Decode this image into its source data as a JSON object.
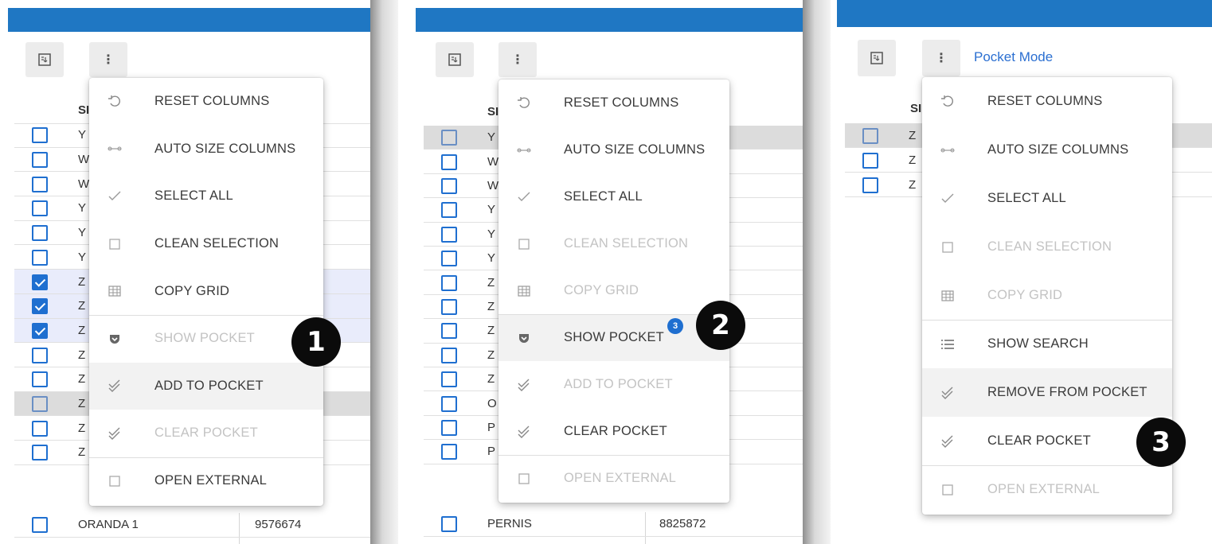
{
  "toolbar": {
    "grid_icon": "grid-export-icon",
    "more_label": "⋮"
  },
  "panel3": {
    "mode_label": "Pocket Mode"
  },
  "header": {
    "column_name_partial": "SI"
  },
  "panel1": {
    "rows": [
      {
        "name": "Y"
      },
      {
        "name": "W"
      },
      {
        "name": "W"
      },
      {
        "name": "Y"
      },
      {
        "name": "Y"
      },
      {
        "name": "Y"
      },
      {
        "name": "Z"
      },
      {
        "name": "Z"
      },
      {
        "name": "Z"
      },
      {
        "name": "Z"
      },
      {
        "name": "Z"
      },
      {
        "name": "Z"
      },
      {
        "name": "Z"
      },
      {
        "name": "Z"
      }
    ],
    "last_row": {
      "name": "ORANDA 1",
      "value": "9576674"
    },
    "menu": [
      {
        "label": "RESET COLUMNS",
        "icon": "undo-icon"
      },
      {
        "label": "AUTO SIZE COLUMNS",
        "icon": "resize-icon"
      },
      {
        "label": "SELECT ALL",
        "icon": "check-icon"
      },
      {
        "label": "CLEAN SELECTION",
        "icon": "checkbox-empty-icon"
      },
      {
        "label": "COPY GRID",
        "icon": "grid-icon"
      },
      {
        "label": "SHOW POCKET",
        "icon": "pocket-icon"
      },
      {
        "label": "ADD TO POCKET",
        "icon": "double-check-icon"
      },
      {
        "label": "CLEAR POCKET",
        "icon": "double-check-icon"
      },
      {
        "label": "OPEN EXTERNAL",
        "icon": "checkbox-empty-icon"
      }
    ],
    "callout": "1"
  },
  "panel2": {
    "rows": [
      {
        "name": "Y"
      },
      {
        "name": "W"
      },
      {
        "name": "W"
      },
      {
        "name": "Y"
      },
      {
        "name": "Y"
      },
      {
        "name": "Y"
      },
      {
        "name": "Z"
      },
      {
        "name": "Z"
      },
      {
        "name": "Z"
      },
      {
        "name": "Z"
      },
      {
        "name": "Z"
      },
      {
        "name": "O"
      },
      {
        "name": "P"
      },
      {
        "name": "P"
      }
    ],
    "last_row": {
      "name": "PERNIS",
      "value": "8825872"
    },
    "menu": [
      {
        "label": "RESET COLUMNS",
        "icon": "undo-icon"
      },
      {
        "label": "AUTO SIZE COLUMNS",
        "icon": "resize-icon"
      },
      {
        "label": "SELECT ALL",
        "icon": "check-icon"
      },
      {
        "label": "CLEAN SELECTION",
        "icon": "checkbox-empty-icon"
      },
      {
        "label": "COPY GRID",
        "icon": "grid-icon"
      },
      {
        "label": "SHOW POCKET",
        "icon": "pocket-icon"
      },
      {
        "label": "ADD TO POCKET",
        "icon": "double-check-icon"
      },
      {
        "label": "CLEAR POCKET",
        "icon": "double-check-icon"
      },
      {
        "label": "OPEN EXTERNAL",
        "icon": "checkbox-empty-icon"
      }
    ],
    "pocket_count": "3",
    "callout": "2"
  },
  "panel3_grid": {
    "rows": [
      {
        "name": "Z"
      },
      {
        "name": "Z"
      },
      {
        "name": "Z"
      }
    ],
    "menu": [
      {
        "label": "RESET COLUMNS",
        "icon": "undo-icon"
      },
      {
        "label": "AUTO SIZE COLUMNS",
        "icon": "resize-icon"
      },
      {
        "label": "SELECT ALL",
        "icon": "check-icon"
      },
      {
        "label": "CLEAN SELECTION",
        "icon": "checkbox-empty-icon"
      },
      {
        "label": "COPY GRID",
        "icon": "grid-icon"
      },
      {
        "label": "SHOW SEARCH",
        "icon": "list-icon"
      },
      {
        "label": "REMOVE FROM POCKET",
        "icon": "double-check-icon"
      },
      {
        "label": "CLEAR POCKET",
        "icon": "double-check-icon"
      },
      {
        "label": "OPEN EXTERNAL",
        "icon": "checkbox-empty-icon"
      }
    ],
    "callout": "3"
  },
  "colors": {
    "accent": "#1f77c3",
    "checkbox": "#1f6fd0",
    "link": "#2b6fd1"
  }
}
